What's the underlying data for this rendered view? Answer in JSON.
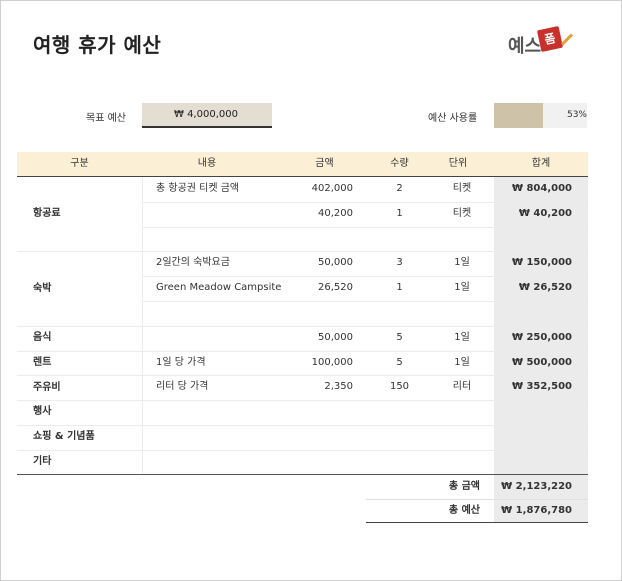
{
  "title": "여행 휴가 예산",
  "logo": {
    "text": "예스",
    "badge": "폼"
  },
  "summary": {
    "goal_label": "목표 예산",
    "goal_value": "₩ 4,000,000",
    "usage_label": "예산 사용률",
    "usage_value": "53%",
    "usage_fraction": 0.53
  },
  "colors": {
    "header_bg": "#fbf0d6",
    "goal_bg": "#e3ddd2",
    "usage_fill": "#cec3a8",
    "sum_col_bg": "#ebebeb"
  },
  "table": {
    "headers": [
      "구분",
      "내용",
      "금액",
      "수량",
      "단위",
      "합계"
    ],
    "categories": [
      "항공료",
      "숙박",
      "음식",
      "렌트",
      "주유비",
      "행사",
      "쇼핑 & 기념품",
      "기타"
    ],
    "rows": [
      {
        "content": "총 항공권 티켓 금액",
        "amount": "402,000",
        "qty": "2",
        "unit": "티켓",
        "total": "₩ 804,000"
      },
      {
        "content": "",
        "amount": "40,200",
        "qty": "1",
        "unit": "티켓",
        "total": "₩ 40,200"
      },
      {
        "content": "",
        "amount": "",
        "qty": "",
        "unit": "",
        "total": ""
      },
      {
        "content": "2일간의 숙박요금",
        "amount": "50,000",
        "qty": "3",
        "unit": "1일",
        "total": "₩ 150,000"
      },
      {
        "content": "Green Meadow Campsite",
        "amount": "26,520",
        "qty": "1",
        "unit": "1일",
        "total": "₩ 26,520"
      },
      {
        "content": "",
        "amount": "",
        "qty": "",
        "unit": "",
        "total": ""
      },
      {
        "content": "",
        "amount": "50,000",
        "qty": "5",
        "unit": "1일",
        "total": "₩ 250,000"
      },
      {
        "content": "1일 당 가격",
        "amount": "100,000",
        "qty": "5",
        "unit": "1일",
        "total": "₩ 500,000"
      },
      {
        "content": "리터 당 가격",
        "amount": "2,350",
        "qty": "150",
        "unit": "리터",
        "total": "₩ 352,500"
      },
      {
        "content": "",
        "amount": "",
        "qty": "",
        "unit": "",
        "total": ""
      },
      {
        "content": "",
        "amount": "",
        "qty": "",
        "unit": "",
        "total": ""
      },
      {
        "content": "",
        "amount": "",
        "qty": "",
        "unit": "",
        "total": ""
      }
    ]
  },
  "totals": {
    "total_amount_label": "총 금액",
    "total_amount": "₩ 2,123,220",
    "total_budget_label": "총 예산",
    "total_budget": "₩ 1,876,780"
  }
}
